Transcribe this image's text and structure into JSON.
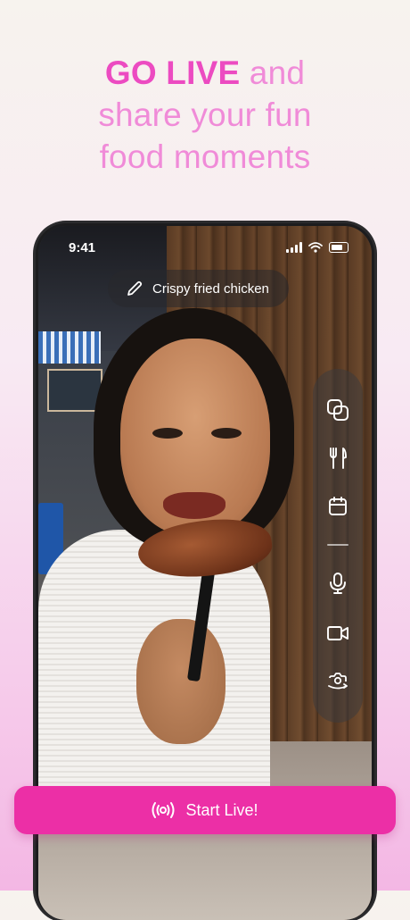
{
  "headline": {
    "strong": "GO LIVE",
    "line1_rest": " and",
    "line2": "share your fun",
    "line3": "food moments"
  },
  "status_bar": {
    "time": "9:41"
  },
  "title_chip": {
    "label": "Crispy fried chicken",
    "icon": "pencil-icon"
  },
  "side_panel": {
    "items": [
      {
        "name": "layers-icon"
      },
      {
        "name": "fork-knife-icon"
      },
      {
        "name": "calendar-icon"
      },
      {
        "name": "microphone-icon"
      },
      {
        "name": "video-camera-icon"
      },
      {
        "name": "camera-flip-icon"
      }
    ]
  },
  "cta": {
    "label": "Start Live!",
    "icon": "broadcast-icon",
    "color": "#ec2fa6"
  },
  "colors": {
    "headline_strong": "#ec4bc1",
    "headline_light": "#f08bd8"
  }
}
